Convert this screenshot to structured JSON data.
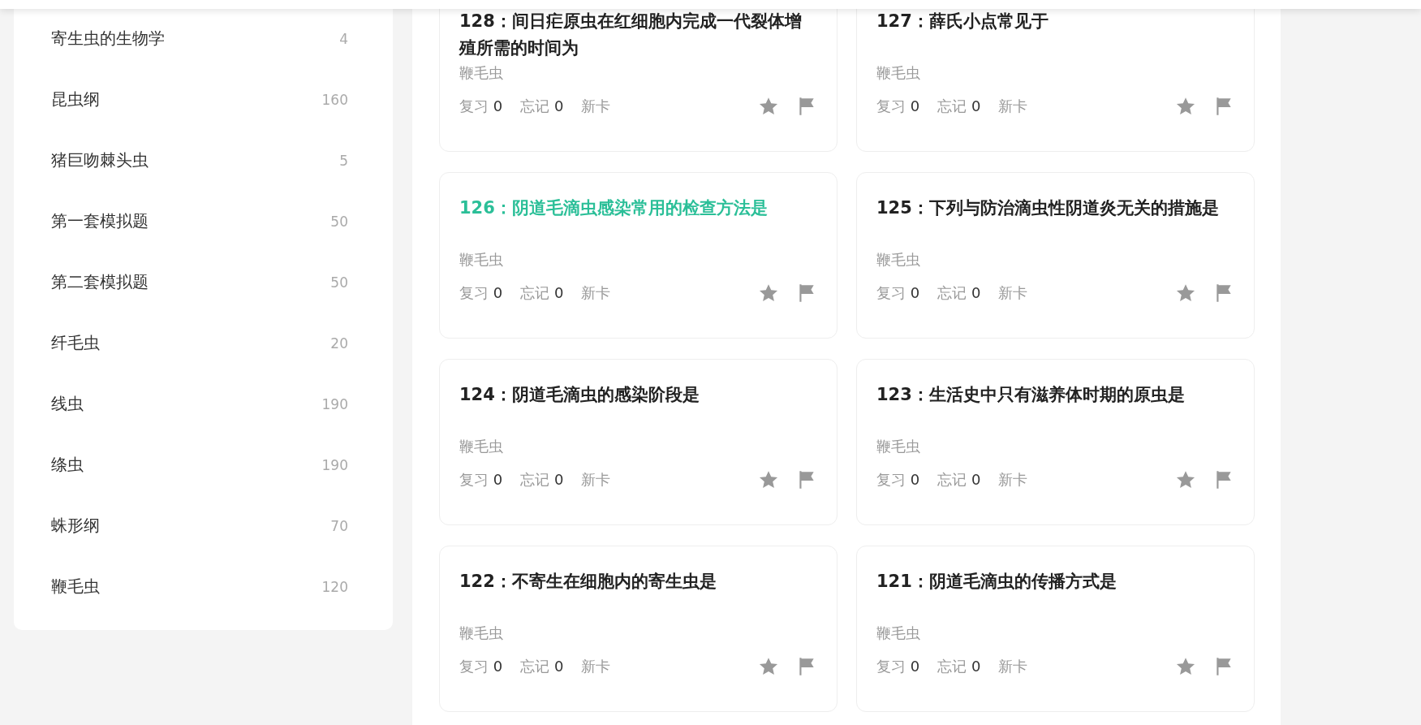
{
  "sidebar": {
    "items": [
      {
        "label": "寄生虫的生物学",
        "count": "4"
      },
      {
        "label": "昆虫纲",
        "count": "160"
      },
      {
        "label": "猪巨吻棘头虫",
        "count": "5"
      },
      {
        "label": "第一套模拟题",
        "count": "50"
      },
      {
        "label": "第二套模拟题",
        "count": "50"
      },
      {
        "label": "纤毛虫",
        "count": "20"
      },
      {
        "label": "线虫",
        "count": "190"
      },
      {
        "label": "绦虫",
        "count": "190"
      },
      {
        "label": "蛛形纲",
        "count": "70"
      },
      {
        "label": "鞭毛虫",
        "count": "120"
      }
    ]
  },
  "cards": [
    {
      "title": "128：间日疟原虫在红细胞内完成一代裂体增殖所需的时间为",
      "selected": false,
      "topic": "鞭毛虫",
      "review_label": "复习",
      "review": "0",
      "forget_label": "忘记",
      "forget": "0",
      "status": "新卡"
    },
    {
      "title": "127：薛氏小点常见于",
      "selected": false,
      "topic": "鞭毛虫",
      "review_label": "复习",
      "review": "0",
      "forget_label": "忘记",
      "forget": "0",
      "status": "新卡"
    },
    {
      "title": "126：阴道毛滴虫感染常用的检查方法是",
      "selected": true,
      "topic": "鞭毛虫",
      "review_label": "复习",
      "review": "0",
      "forget_label": "忘记",
      "forget": "0",
      "status": "新卡"
    },
    {
      "title": "125：下列与防治滴虫性阴道炎无关的措施是",
      "selected": false,
      "topic": "鞭毛虫",
      "review_label": "复习",
      "review": "0",
      "forget_label": "忘记",
      "forget": "0",
      "status": "新卡"
    },
    {
      "title": "124：阴道毛滴虫的感染阶段是",
      "selected": false,
      "topic": "鞭毛虫",
      "review_label": "复习",
      "review": "0",
      "forget_label": "忘记",
      "forget": "0",
      "status": "新卡"
    },
    {
      "title": "123：生活史中只有滋养体时期的原虫是",
      "selected": false,
      "topic": "鞭毛虫",
      "review_label": "复习",
      "review": "0",
      "forget_label": "忘记",
      "forget": "0",
      "status": "新卡"
    },
    {
      "title": "122：不寄生在细胞内的寄生虫是",
      "selected": false,
      "topic": "鞭毛虫",
      "review_label": "复习",
      "review": "0",
      "forget_label": "忘记",
      "forget": "0",
      "status": "新卡"
    },
    {
      "title": "121：阴道毛滴虫的传播方式是",
      "selected": false,
      "topic": "鞭毛虫",
      "review_label": "复习",
      "review": "0",
      "forget_label": "忘记",
      "forget": "0",
      "status": "新卡"
    }
  ]
}
